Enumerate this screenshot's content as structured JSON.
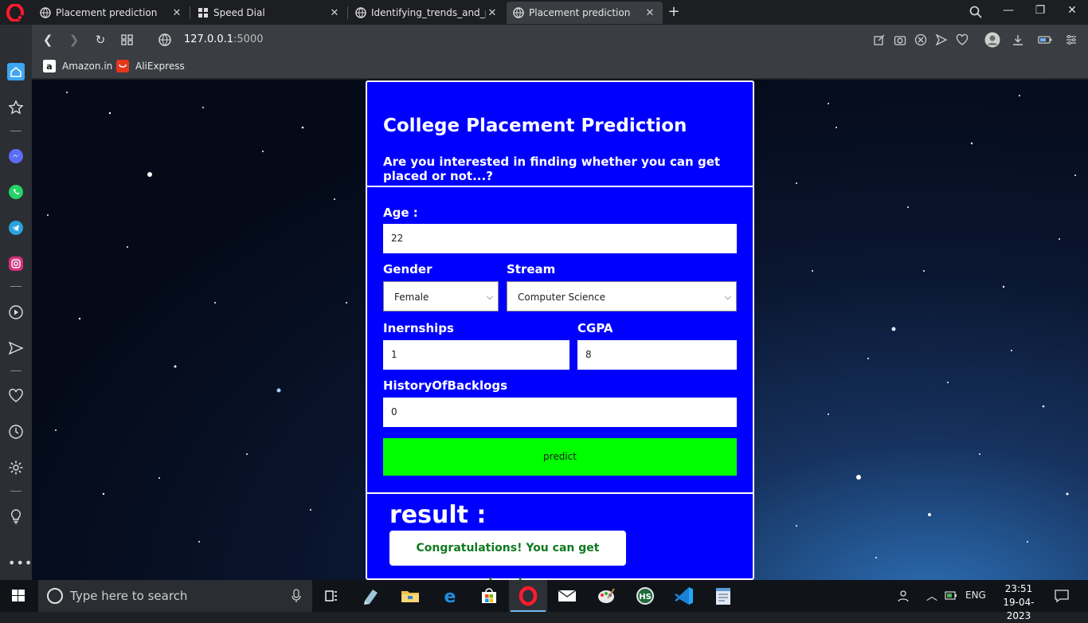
{
  "browser": {
    "tabs": [
      {
        "title": "Placement prediction",
        "active": false
      },
      {
        "title": "Speed Dial",
        "active": false
      },
      {
        "title": "Identifying_trends_and_patt",
        "active": false
      },
      {
        "title": "Placement prediction",
        "active": true
      }
    ],
    "url_host": "127.0.0.1",
    "url_port": ":5000",
    "bookmarks": [
      {
        "label": "Amazon.in",
        "icon": "amazon-icon"
      },
      {
        "label": "AliExpress",
        "icon": "aliexpress-icon"
      }
    ]
  },
  "page": {
    "title": "College Placement Prediction",
    "subtitle": "Are you interested in finding whether you can get placed or not...?",
    "form": {
      "age_label": "Age :",
      "age_value": "22",
      "gender_label": "Gender",
      "gender_value": "Female",
      "stream_label": "Stream",
      "stream_value": "Computer Science",
      "internships_label": "Inernships",
      "internships_value": "1",
      "cgpa_label": "CGPA",
      "cgpa_value": "8",
      "backlogs_label": "HistoryOfBacklogs",
      "backlogs_value": "0",
      "predict_label": "predict"
    },
    "result": {
      "heading": "result :",
      "message": "Congratulations! You can get placed..."
    },
    "colors": {
      "card": "#0000fe",
      "predict": "#00ff00",
      "result_text": "#0f7a1f"
    }
  },
  "taskbar": {
    "search_placeholder": "Type here to search",
    "language": "ENG",
    "time": "23:51",
    "date": "19-04-2023"
  }
}
